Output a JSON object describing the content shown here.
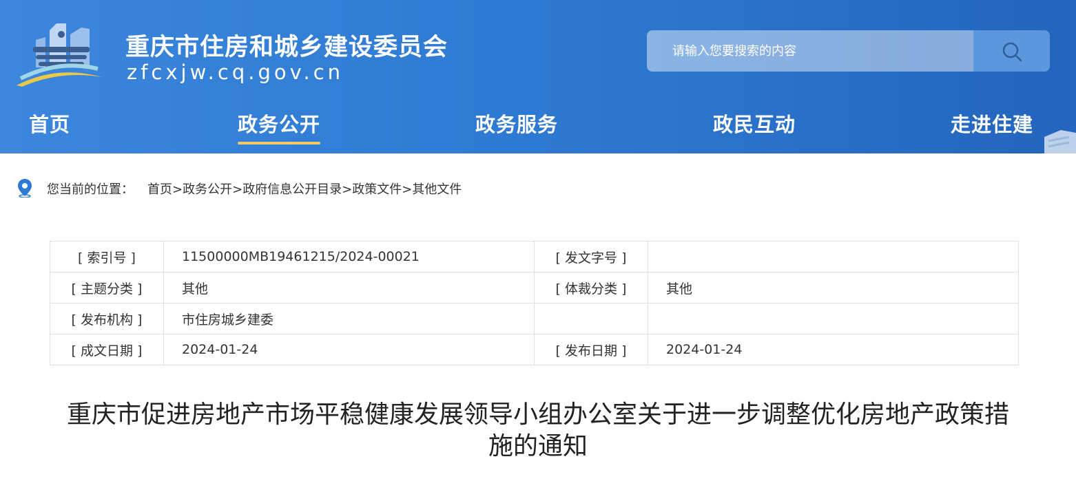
{
  "header": {
    "site_title": "重庆市住房和城乡建设委员会",
    "site_domain": "zfcxjw.cq.gov.cn",
    "logo_icon": "government-building-logo",
    "search": {
      "placeholder": "请输入您要搜索的内容",
      "icon": "search-icon"
    }
  },
  "nav": {
    "items": [
      {
        "label": "首页"
      },
      {
        "label": "政务公开",
        "active": true
      },
      {
        "label": "政务服务"
      },
      {
        "label": "政民互动"
      },
      {
        "label": "走进住建"
      }
    ],
    "active_underline_color": "#f3c96b"
  },
  "breadcrumb": {
    "icon": "location-pin-icon",
    "label": "您当前的位置：",
    "path": [
      "首页",
      ">",
      "政务公开",
      ">",
      "政府信息公开目录",
      ">",
      "政策文件",
      ">",
      "其他文件"
    ]
  },
  "meta": {
    "rows": [
      [
        "[ 索引号 ]",
        "11500000MB19461215/2024-00021",
        "[ 发文字号 ]",
        ""
      ],
      [
        "[ 主题分类 ]",
        "其他",
        "[ 体裁分类 ]",
        "其他"
      ],
      [
        "[ 发布机构 ]",
        "市住房城乡建委",
        "",
        ""
      ],
      [
        "[ 成文日期 ]",
        "2024-01-24",
        "[ 发布日期 ]",
        "2024-01-24"
      ]
    ]
  },
  "document": {
    "title_line1": "重庆市促进房地产市场平稳健康发展领导小组办公室关于进一步调整优化房地产政策措",
    "title_line2": "施的通知"
  },
  "colors": {
    "header_blue": "#2f7bd3",
    "accent_yellow": "#f3c96b"
  }
}
